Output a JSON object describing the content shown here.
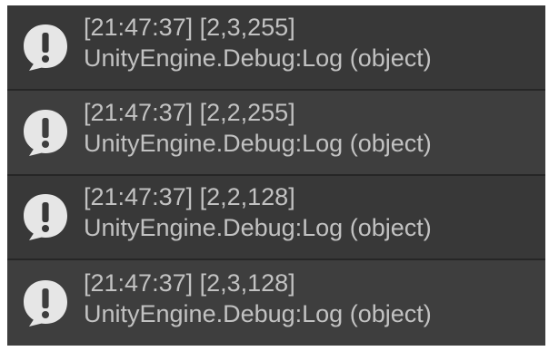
{
  "console": {
    "entries": [
      {
        "icon": "info-speech-bubble-icon",
        "message": "[21:47:37] [2,3,255]",
        "stack": "UnityEngine.Debug:Log (object)"
      },
      {
        "icon": "info-speech-bubble-icon",
        "message": "[21:47:37] [2,2,255]",
        "stack": "UnityEngine.Debug:Log (object)"
      },
      {
        "icon": "info-speech-bubble-icon",
        "message": "[21:47:37] [2,2,128]",
        "stack": "UnityEngine.Debug:Log (object)"
      },
      {
        "icon": "info-speech-bubble-icon",
        "message": "[21:47:37] [2,3,128]",
        "stack": "UnityEngine.Debug:Log (object)"
      }
    ],
    "colors": {
      "background": "#2f2f2f",
      "row_odd": "#383838",
      "row_even": "#3e3e3e",
      "text": "#c2c2c2",
      "icon": "#e6e6e6"
    }
  }
}
